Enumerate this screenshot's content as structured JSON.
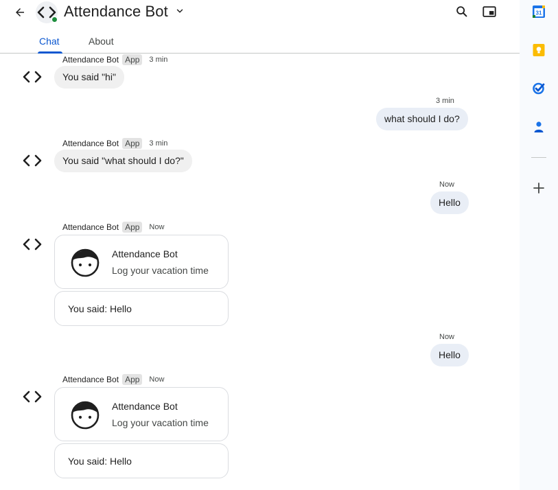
{
  "header": {
    "title": "Attendance Bot",
    "icons": [
      "back-arrow-icon",
      "code-brackets-icon",
      "chevron-down-icon",
      "search-icon",
      "picture-in-picture-icon"
    ]
  },
  "tabs": [
    {
      "label": "Chat",
      "active": true
    },
    {
      "label": "About",
      "active": false
    }
  ],
  "colors": {
    "accent": "#0b57d0",
    "status_online": "#1e8e3e",
    "incoming_bubble": "#f0f0f0",
    "outgoing_bubble": "#e9eef6"
  },
  "messages": [
    {
      "sender": "Attendance Bot",
      "badge": "App",
      "time": "3 min",
      "text": "You said \"hi\""
    },
    {
      "time": "3 min",
      "text": "what should I do?"
    },
    {
      "sender": "Attendance Bot",
      "badge": "App",
      "time": "3 min",
      "text": "You said \"what should I do?\""
    },
    {
      "time": "Now",
      "text": "Hello"
    },
    {
      "sender": "Attendance Bot",
      "badge": "App",
      "time": "Now",
      "card": {
        "title": "Attendance Bot",
        "subtitle": "Log your vacation time",
        "text": "You said: Hello"
      }
    },
    {
      "time": "Now",
      "text": "Hello"
    },
    {
      "sender": "Attendance Bot",
      "badge": "App",
      "time": "Now",
      "card": {
        "title": "Attendance Bot",
        "subtitle": "Log your vacation time",
        "text": "You said: Hello"
      }
    }
  ],
  "side_rail": {
    "calendar_day": "31",
    "icons": [
      "calendar-icon",
      "keep-icon",
      "tasks-icon",
      "contacts-icon",
      "add-icon"
    ]
  }
}
